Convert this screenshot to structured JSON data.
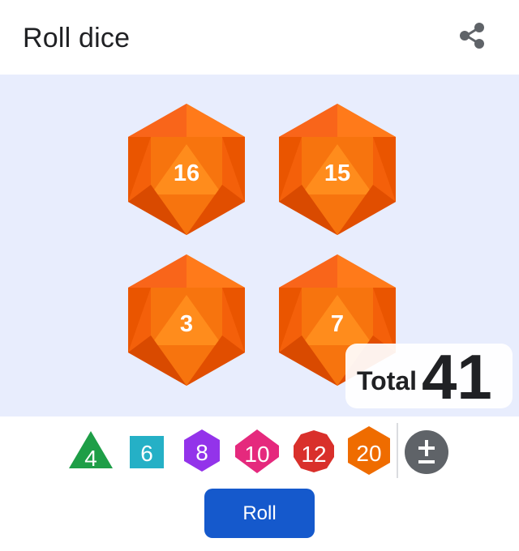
{
  "header": {
    "title": "Roll dice"
  },
  "icons": {
    "share": "share-icon",
    "add_remove": "plus-minus-icon"
  },
  "dice": [
    {
      "sides": 20,
      "value": "16"
    },
    {
      "sides": 20,
      "value": "15"
    },
    {
      "sides": 20,
      "value": "3"
    },
    {
      "sides": 20,
      "value": "7"
    }
  ],
  "total": {
    "label": "Total",
    "value": "41"
  },
  "die_types": [
    {
      "label": "4",
      "color": "#1e9e47"
    },
    {
      "label": "6",
      "color": "#25b0c6"
    },
    {
      "label": "8",
      "color": "#9333ea"
    },
    {
      "label": "10",
      "color": "#e5297d"
    },
    {
      "label": "12",
      "color": "#d9302b"
    },
    {
      "label": "20",
      "color": "#ef6c00"
    }
  ],
  "colors": {
    "tray": "#e8edfd",
    "die": "#f26b10",
    "roll_button": "#1559cc"
  },
  "roll_button": {
    "label": "Roll"
  }
}
